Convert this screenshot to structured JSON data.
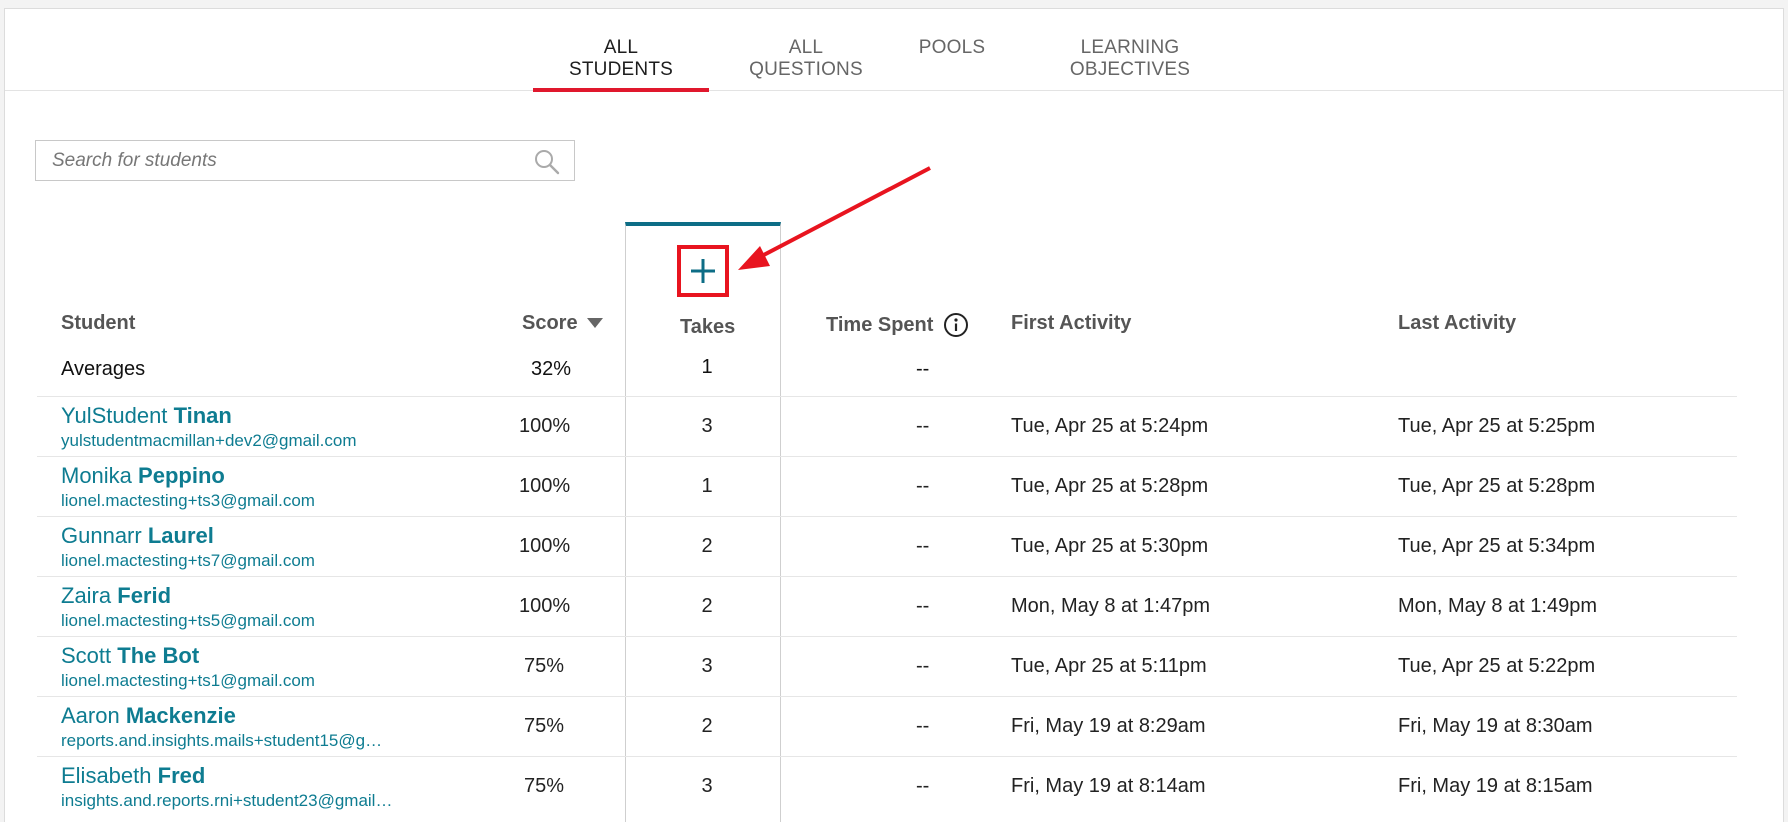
{
  "tabs": [
    {
      "label": "ALL STUDENTS",
      "active": true
    },
    {
      "label": "ALL QUESTIONS",
      "active": false
    },
    {
      "label": "POOLS",
      "active": false
    },
    {
      "label": "LEARNING OBJECTIVES",
      "active": false
    }
  ],
  "search": {
    "placeholder": "Search for students"
  },
  "table": {
    "headers": {
      "student": "Student",
      "score": "Score",
      "takes": "Takes",
      "time_spent": "Time Spent",
      "first_activity": "First Activity",
      "last_activity": "Last Activity"
    },
    "averages": {
      "label": "Averages",
      "score": "32%",
      "takes": "1",
      "time_spent": "--"
    },
    "rows": [
      {
        "first": "YulStudent",
        "last": "Tinan",
        "email": "yulstudentmacmillan+dev2@gmail.com",
        "score": "100%",
        "takes": "3",
        "time_spent": "--",
        "first_activity": "Tue, Apr 25 at 5:24pm",
        "last_activity": "Tue, Apr 25 at 5:25pm"
      },
      {
        "first": "Monika",
        "last": "Peppino",
        "email": "lionel.mactesting+ts3@gmail.com",
        "score": "100%",
        "takes": "1",
        "time_spent": "--",
        "first_activity": "Tue, Apr 25 at 5:28pm",
        "last_activity": "Tue, Apr 25 at 5:28pm"
      },
      {
        "first": "Gunnarr",
        "last": "Laurel",
        "email": "lionel.mactesting+ts7@gmail.com",
        "score": "100%",
        "takes": "2",
        "time_spent": "--",
        "first_activity": "Tue, Apr 25 at 5:30pm",
        "last_activity": "Tue, Apr 25 at 5:34pm"
      },
      {
        "first": "Zaira",
        "last": "Ferid",
        "email": "lionel.mactesting+ts5@gmail.com",
        "score": "100%",
        "takes": "2",
        "time_spent": "--",
        "first_activity": "Mon, May 8 at 1:47pm",
        "last_activity": "Mon, May 8 at 1:49pm"
      },
      {
        "first": "Scott",
        "last": "The Bot",
        "email": "lionel.mactesting+ts1@gmail.com",
        "score": "75%",
        "takes": "3",
        "time_spent": "--",
        "first_activity": "Tue, Apr 25 at 5:11pm",
        "last_activity": "Tue, Apr 25 at 5:22pm"
      },
      {
        "first": "Aaron",
        "last": "Mackenzie",
        "email": "reports.and.insights.mails+student15@g…",
        "score": "75%",
        "takes": "2",
        "time_spent": "--",
        "first_activity": "Fri, May 19 at 8:29am",
        "last_activity": "Fri, May 19 at 8:30am"
      },
      {
        "first": "Elisabeth",
        "last": "Fred",
        "email": "insights.and.reports.rni+student23@gmail…",
        "score": "75%",
        "takes": "3",
        "time_spent": "--",
        "first_activity": "Fri, May 19 at 8:14am",
        "last_activity": "Fri, May 19 at 8:15am"
      }
    ]
  },
  "colors": {
    "accent_red": "#e0182d",
    "link_teal": "#0e7c91",
    "column_highlight": "#0d6d86"
  }
}
